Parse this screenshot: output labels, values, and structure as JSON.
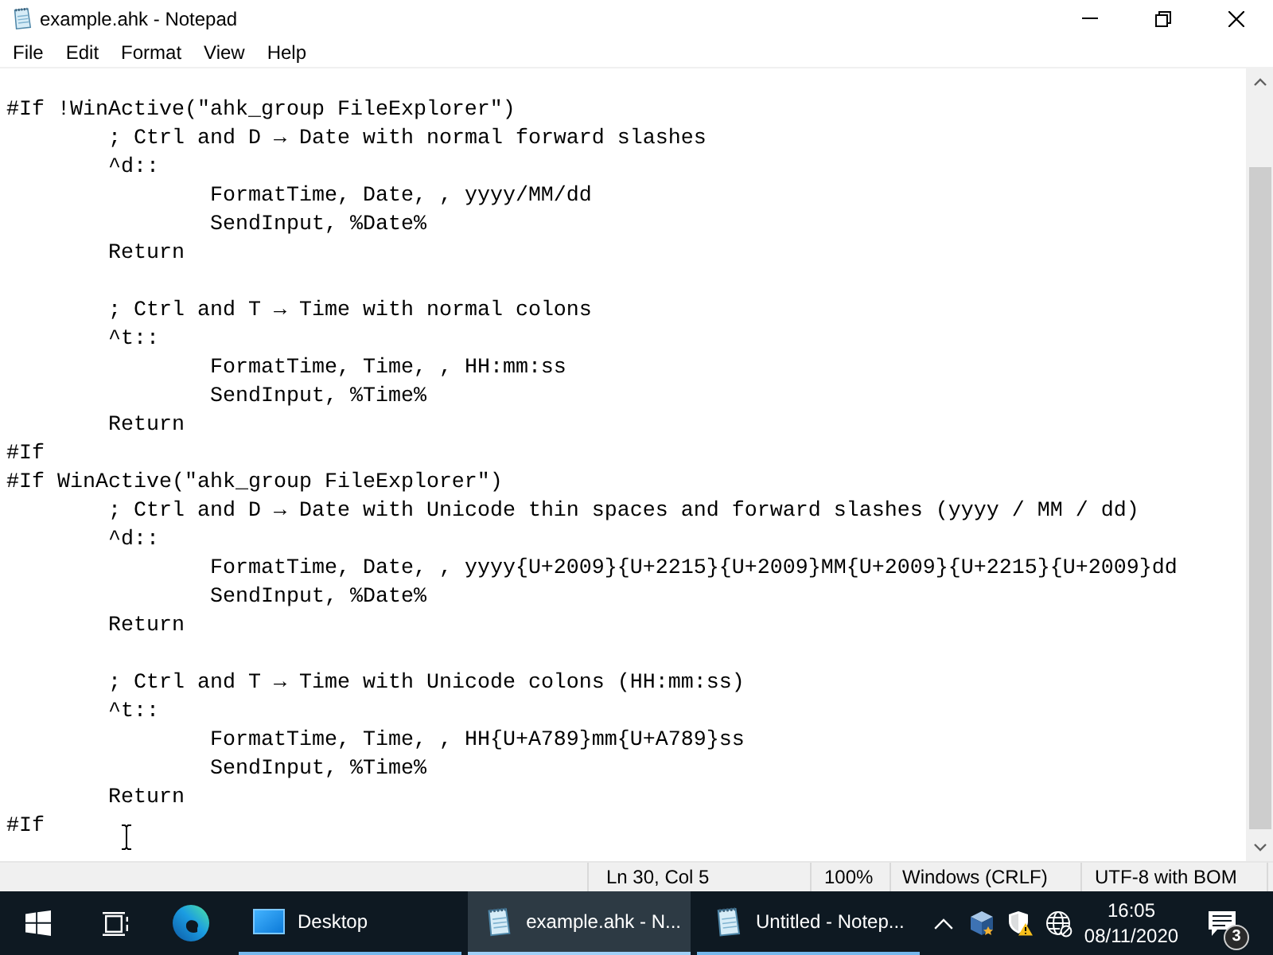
{
  "window": {
    "title": "example.ahk - Notepad"
  },
  "menu": [
    "File",
    "Edit",
    "Format",
    "View",
    "Help"
  ],
  "editor": {
    "blocks": [
      [
        "#If !WinActive(\"ahk_group FileExplorer\")",
        "\t; Ctrl and D → Date with normal forward slashes",
        "\t^d::",
        "\t\tFormatTime, Date, , yyyy/MM/dd",
        "\t\tSendInput, %Date%",
        "\tReturn"
      ],
      [
        "\t; Ctrl and T → Time with normal colons",
        "\t^t::",
        "\t\tFormatTime, Time, , HH:mm:ss",
        "\t\tSendInput, %Time%",
        "\tReturn",
        "#If",
        "#If WinActive(\"ahk_group FileExplorer\")",
        "\t; Ctrl and D → Date with Unicode thin spaces and forward slashes (yyyy / MM / dd)",
        "\t^d::",
        "\t\tFormatTime, Date, , yyyy{U+2009}{U+2215}{U+2009}MM{U+2009}{U+2215}{U+2009}dd",
        "\t\tSendInput, %Date%",
        "\tReturn"
      ],
      [
        "\t; Ctrl and T → Time with Unicode colons (HH:mm:ss)",
        "\t^t::",
        "\t\tFormatTime, Time, , HH{U+A789}mm{U+A789}ss",
        "\t\tSendInput, %Time%",
        "\tReturn",
        "#If"
      ]
    ]
  },
  "status_bar": [
    "Ln 30, Col 5",
    "100%",
    "Windows (CRLF)",
    "UTF-8 with BOM"
  ],
  "taskbar": {
    "apps": [
      {
        "kind": "desktop",
        "label": "Desktop",
        "selected": false
      },
      {
        "kind": "notepad",
        "label": "example.ahk - N...",
        "selected": true
      },
      {
        "kind": "notepad",
        "label": "Untitled - Notep...",
        "selected": false
      }
    ],
    "clock": {
      "time": "16:05",
      "date": "08/11/2020"
    },
    "notifications": {
      "count": "3"
    }
  }
}
